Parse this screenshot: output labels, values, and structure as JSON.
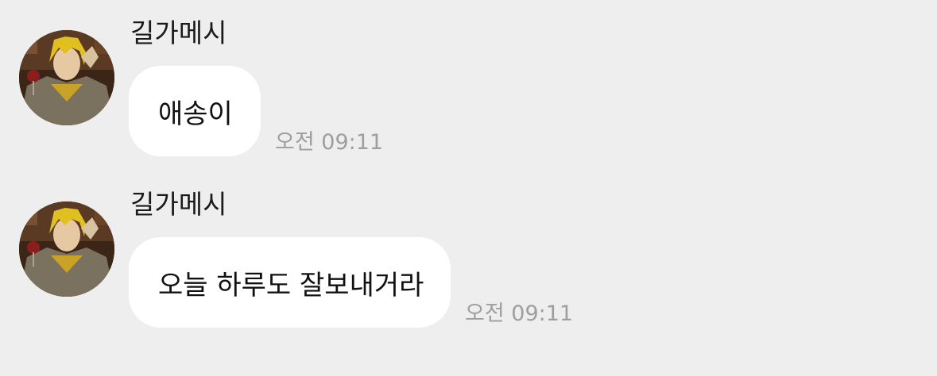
{
  "messages": [
    {
      "sender": "길가메시",
      "text": "애송이",
      "time": "오전 09:11"
    },
    {
      "sender": "길가메시",
      "text": "오늘 하루도 잘보내거라",
      "time": "오전 09:11"
    }
  ],
  "colors": {
    "background": "#eeeeee",
    "bubble": "#ffffff",
    "text": "#111111",
    "time": "#9e9e9e"
  },
  "icons": {
    "avatar": "profile-avatar-icon"
  }
}
